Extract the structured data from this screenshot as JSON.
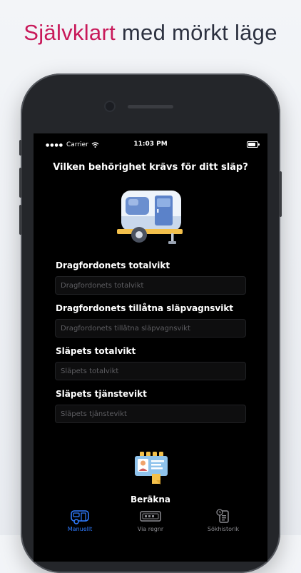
{
  "headline": {
    "accent": "Självklart",
    "rest": " med mörkt läge"
  },
  "status_bar": {
    "carrier": "Carrier",
    "time": "11:03 PM"
  },
  "question": "Vilken behörighet krävs för ditt släp?",
  "fields": [
    {
      "label": "Dragfordonets totalvikt",
      "placeholder": "Dragfordonets totalvikt"
    },
    {
      "label": "Dragfordonets tillåtna släpvagnsvikt",
      "placeholder": "Dragfordonets tillåtna släpvagnsvikt"
    },
    {
      "label": "Släpets totalvikt",
      "placeholder": "Släpets totalvikt"
    },
    {
      "label": "Släpets tjänstevikt",
      "placeholder": "Släpets tjänstevikt"
    }
  ],
  "calculate_label": "Beräkna",
  "tabs": [
    {
      "label": "Manuellt",
      "icon": "trailer-icon",
      "active": true
    },
    {
      "label": "Via regnr",
      "icon": "license-plate-icon",
      "active": false
    },
    {
      "label": "Sökhistorik",
      "icon": "history-icon",
      "active": false
    }
  ],
  "colors": {
    "accent": "#c8195a",
    "active_tab": "#2f7bff",
    "screen_bg": "#000000"
  }
}
